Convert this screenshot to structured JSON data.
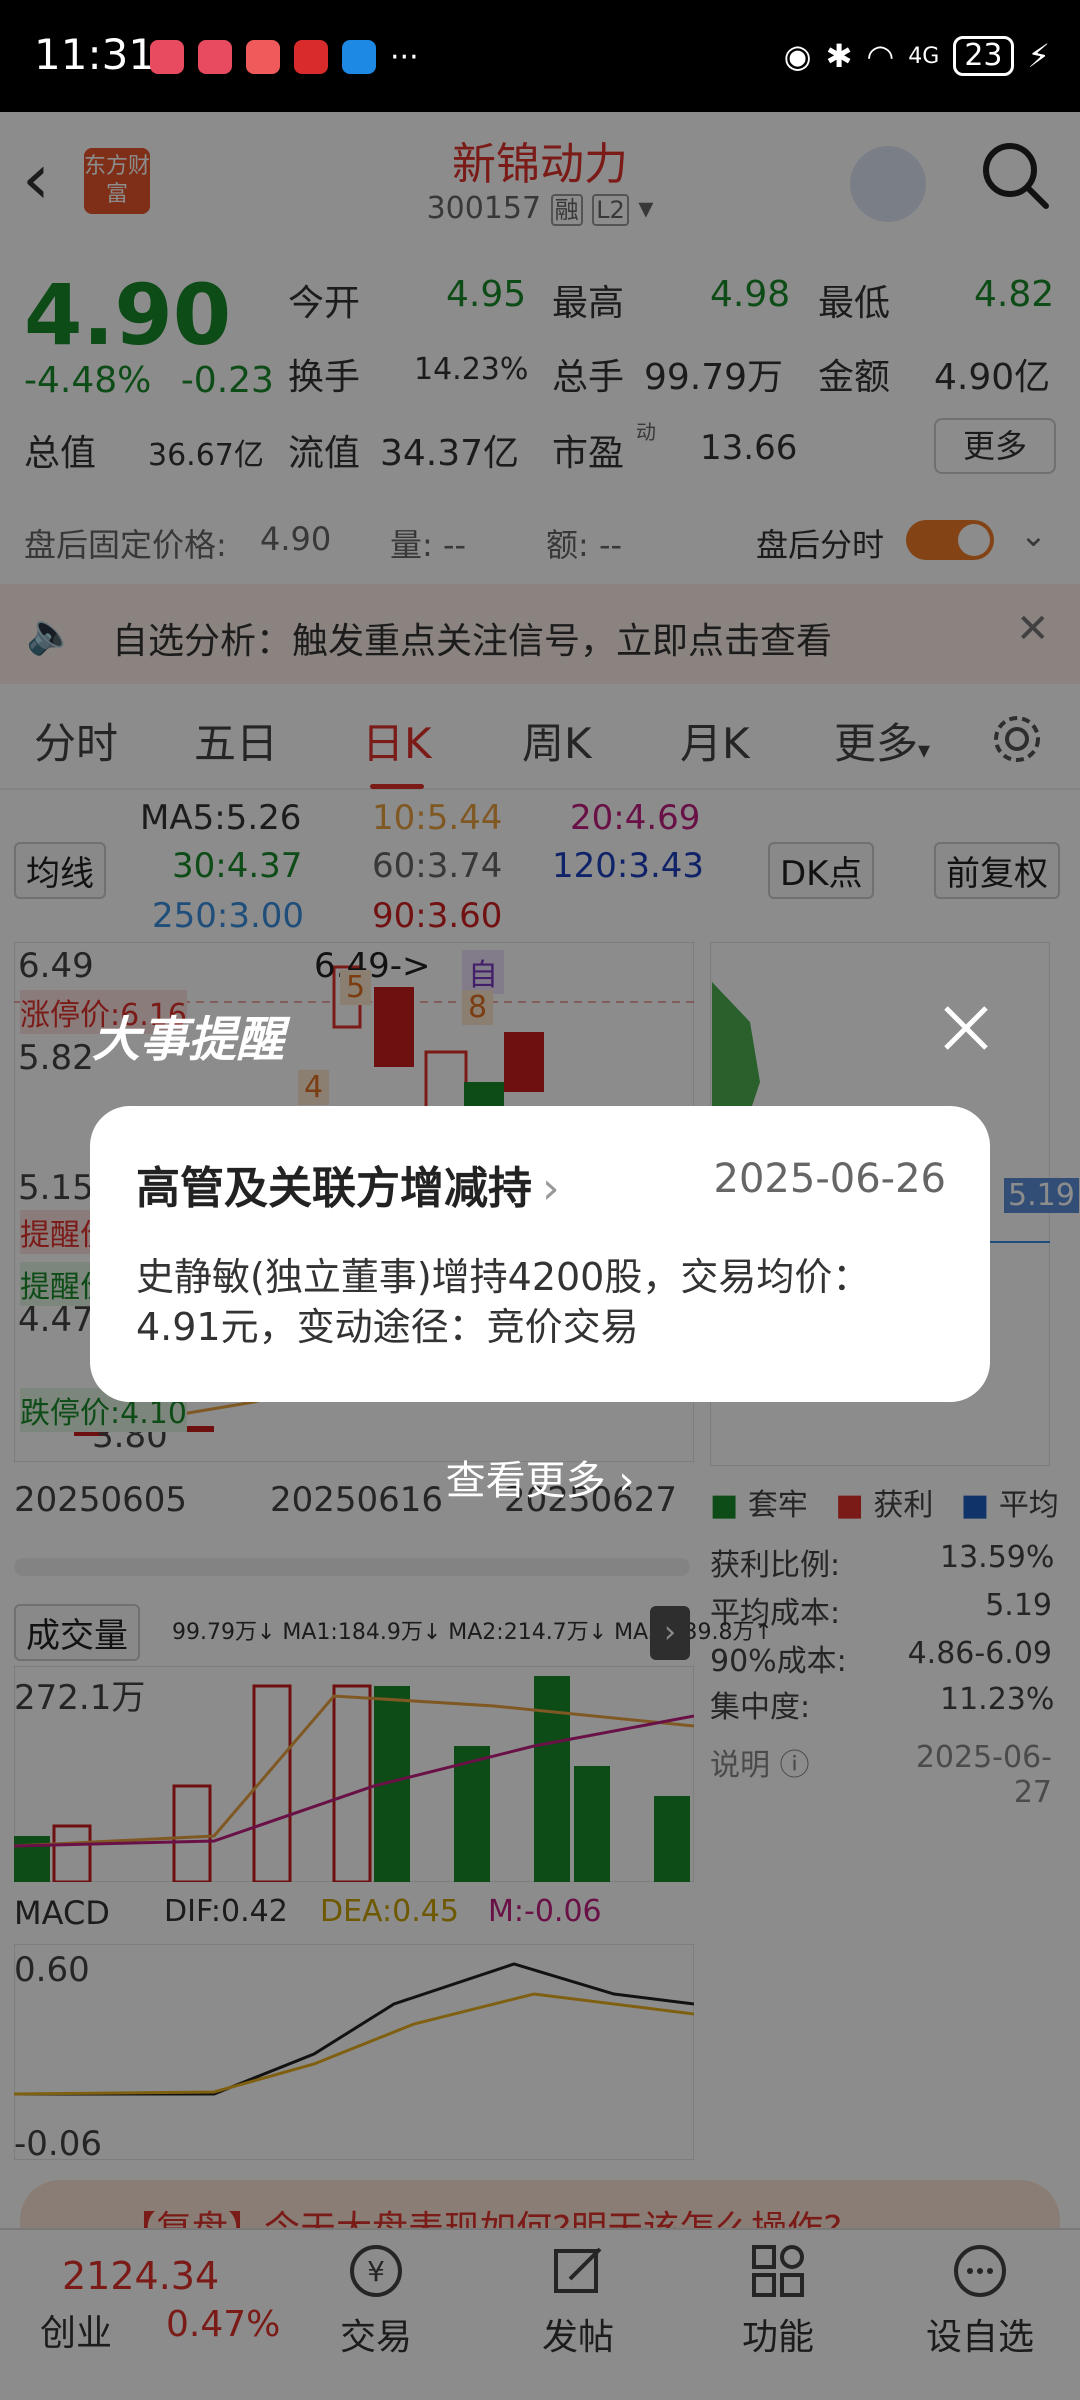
{
  "status_bar": {
    "time": "11:31",
    "network": "4G",
    "battery": "23",
    "more": "···"
  },
  "header": {
    "title": "新锦动力",
    "code": "300157",
    "badge_rong": "融",
    "badge_l2": "L2",
    "logo_text": "东方财富"
  },
  "quote": {
    "price": "4.90",
    "change_pct": "-4.48%",
    "change_abs": "-0.23",
    "open_label": "今开",
    "open": "4.95",
    "high_label": "最高",
    "high": "4.98",
    "low_label": "最低",
    "low": "4.82",
    "turnover_label": "换手",
    "turnover": "14.23%",
    "volume_label": "总手",
    "volume": "99.79万",
    "amount_label": "金额",
    "amount": "4.90亿",
    "mktcap_label": "总值",
    "mktcap": "36.67亿",
    "float_label": "流值",
    "float_cap": "34.37亿",
    "pe_label": "市盈",
    "pe_sup": "动",
    "pe": "13.66",
    "more_label": "更多"
  },
  "after_hours": {
    "price_label": "盘后固定价格:",
    "price": "4.90",
    "vol_label": "量: --",
    "amt_label": "额: --",
    "toggle_label": "盘后分时"
  },
  "alert": {
    "text": "自选分析：触发重点关注信号，立即点击查看"
  },
  "tabs": [
    {
      "label": "分时"
    },
    {
      "label": "五日"
    },
    {
      "label": "日K"
    },
    {
      "label": "周K"
    },
    {
      "label": "月K"
    },
    {
      "label": "更多"
    }
  ],
  "chart": {
    "ma_select": "均线",
    "ma5": "MA5:5.26",
    "ma10": "10:5.44",
    "ma20": "20:4.69",
    "ma30": "30:4.37",
    "ma60": "60:3.74",
    "ma120": "120:3.43",
    "ma250": "250:3.00",
    "ma90": "90:3.60",
    "dk_label": "DK点",
    "adjust_label": "前复权",
    "y_top": "6.49",
    "y_mid": "5.82",
    "y_low": "5.15",
    "y_low2": "4.47",
    "y_bottom": "3.80",
    "high_pointer": "6.49->",
    "limit_up": "涨停价:6.16",
    "limit_down": "跌停价:4.10",
    "remind1": "提醒价",
    "remind2": "提醒价",
    "marker_zi": "自",
    "marker_5": "5",
    "marker_8": "8",
    "marker_4": "4",
    "date1": "20250605",
    "date2": "20250616",
    "date3": "20250627",
    "vol_label": "成交量",
    "vol_values": "99.79万↓ MA1:184.9万↓ MA2:214.7万↓ MA3:139.8万↑",
    "vol_top": "272.1万",
    "macd_label": "MACD",
    "dif": "DIF:0.42",
    "dea": "DEA:0.45",
    "m": "M:-0.06",
    "macd_top": "0.60",
    "macd_bottom": "-0.06",
    "chip_price": "5.19"
  },
  "chips": {
    "legend_trapped": "套牢",
    "legend_profit": "获利",
    "legend_avg": "平均",
    "profit_ratio_label": "获利比例:",
    "profit_ratio": "13.59%",
    "avg_cost_label": "平均成本:",
    "avg_cost": "5.19",
    "cost90_label": "90%成本:",
    "cost90": "4.86-6.09",
    "concentration_label": "集中度:",
    "concentration": "11.23%",
    "note_label": "说明",
    "note_date": "2025-06-27"
  },
  "banner": {
    "text": "【复盘】今天大盘表现如何?明天该怎么操作?"
  },
  "bottom_bar": {
    "index_value": "2124.34",
    "index_name": "创业",
    "index_change": "0.47%",
    "trade": "交易",
    "post": "发帖",
    "features": "功能",
    "add_watch": "设自选"
  },
  "modal": {
    "banner_title": "大事提醒",
    "card_title": "高管及关联方增减持",
    "card_date": "2025-06-26",
    "card_body": "史静敏(独立董事)增持4200股，交易均价：4.91元，变动途径：竞价交易",
    "see_more": "查看更多"
  }
}
